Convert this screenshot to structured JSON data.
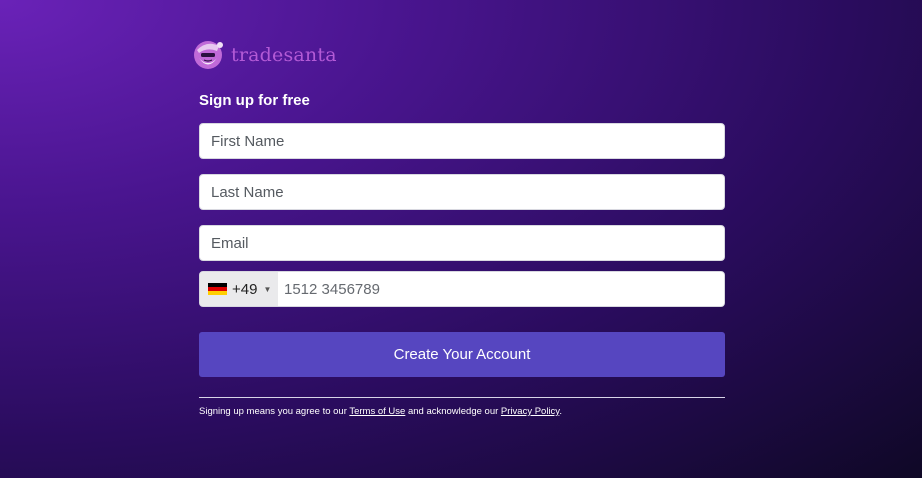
{
  "brand": {
    "name": "tradesanta"
  },
  "form": {
    "heading": "Sign up for free",
    "first_name_placeholder": "First Name",
    "last_name_placeholder": "Last Name",
    "email_placeholder": "Email",
    "phone": {
      "country_flag": "germany-flag",
      "dial_code": "+49",
      "placeholder": "1512 3456789"
    },
    "submit_label": "Create Your Account"
  },
  "legal": {
    "prefix": "Signing up means you agree to our ",
    "terms_label": "Terms of Use",
    "middle": " and acknowledge our ",
    "privacy_label": "Privacy Policy",
    "suffix": "."
  },
  "colors": {
    "accent_button": "#5646c0",
    "brand_text": "#b35ad6",
    "background_dark": "#0f0826",
    "background_light": "#6a22b8"
  }
}
